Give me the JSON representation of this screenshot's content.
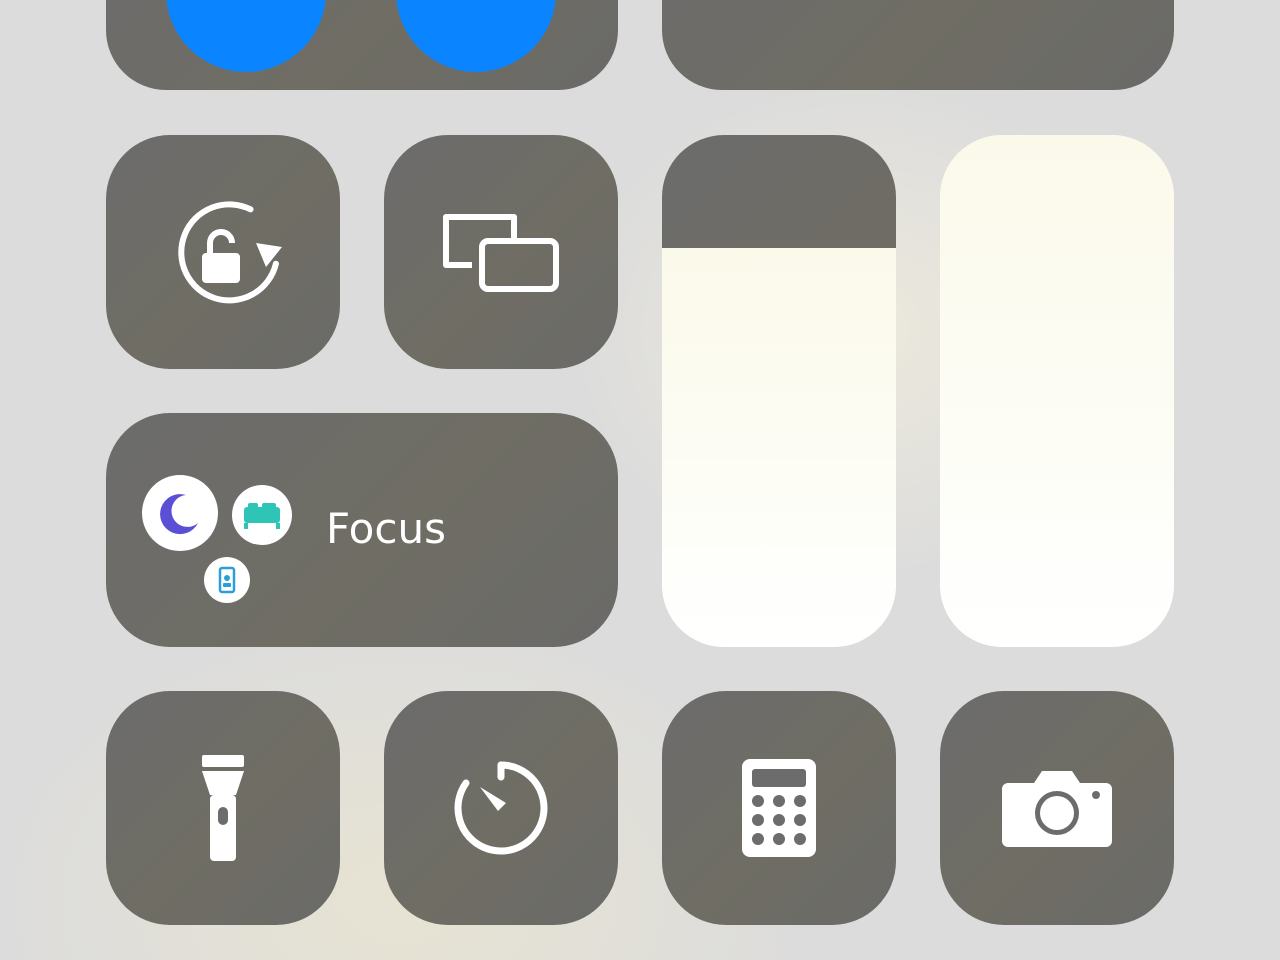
{
  "focus": {
    "label": "Focus",
    "mode_icons": [
      "moon-icon",
      "bed-icon",
      "work-badge-icon"
    ]
  },
  "controls": {
    "top_left": [
      "connectivity-button-1",
      "connectivity-button-2"
    ],
    "top_right": "media-tile",
    "orientation_lock": "rotation-lock-icon",
    "screen_mirroring": "screen-mirroring-icon",
    "flashlight": "flashlight-icon",
    "timer": "timer-icon",
    "calculator": "calculator-icon",
    "camera": "camera-icon"
  },
  "sliders": {
    "brightness": {
      "icon": "sun-icon",
      "level": 0.78
    },
    "volume": {
      "icon": "speaker-icon",
      "level": 1.0
    }
  },
  "colors": {
    "tile": "#6c6c6c",
    "accent_blue": "#0a84ff",
    "moon": "#5b4fd6",
    "bed": "#2ec4b6"
  }
}
